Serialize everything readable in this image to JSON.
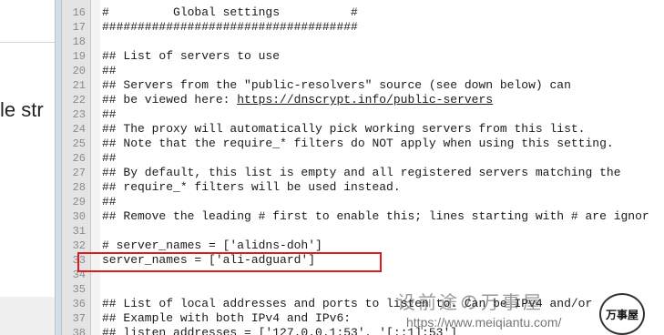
{
  "background_window": {
    "partial_text": "le str"
  },
  "editor": {
    "lines": [
      {
        "n": "16",
        "text": "#         Global settings          #"
      },
      {
        "n": "17",
        "text": "####################################"
      },
      {
        "n": "18",
        "text": ""
      },
      {
        "n": "19",
        "text": "## List of servers to use"
      },
      {
        "n": "20",
        "text": "##"
      },
      {
        "n": "21",
        "text": "## Servers from the \"public-resolvers\" source (see down below) can"
      },
      {
        "n": "22",
        "text": "## be viewed here: ",
        "link": "https://dnscrypt.info/public-servers"
      },
      {
        "n": "23",
        "text": "##"
      },
      {
        "n": "24",
        "text": "## The proxy will automatically pick working servers from this list."
      },
      {
        "n": "25",
        "text": "## Note that the require_* filters do NOT apply when using this setting."
      },
      {
        "n": "26",
        "text": "##"
      },
      {
        "n": "27",
        "text": "## By default, this list is empty and all registered servers matching the"
      },
      {
        "n": "28",
        "text": "## require_* filters will be used instead."
      },
      {
        "n": "29",
        "text": "##"
      },
      {
        "n": "30",
        "text": "## Remove the leading # first to enable this; lines starting with # are ignor"
      },
      {
        "n": "31",
        "text": ""
      },
      {
        "n": "32",
        "text": "# server_names = ['alidns-doh']"
      },
      {
        "n": "33",
        "text": "server_names = ['ali-adguard']"
      },
      {
        "n": "34",
        "text": ""
      },
      {
        "n": "35",
        "text": ""
      },
      {
        "n": "36",
        "text": "## List of local addresses and ports to listen to. Can be IPv4 and/or"
      },
      {
        "n": "37",
        "text": "## Example with both IPv4 and IPv6:"
      },
      {
        "n": "38",
        "text": "## listen_addresses = ['127.0.0.1:53', '[::1]:53']"
      }
    ]
  },
  "highlight": {
    "color": "#e01b1b",
    "line": "33"
  },
  "watermark": {
    "title": "设前途の万事屋",
    "url": "https://www.meiqiantu.com/",
    "logo_text": "万事屋"
  }
}
